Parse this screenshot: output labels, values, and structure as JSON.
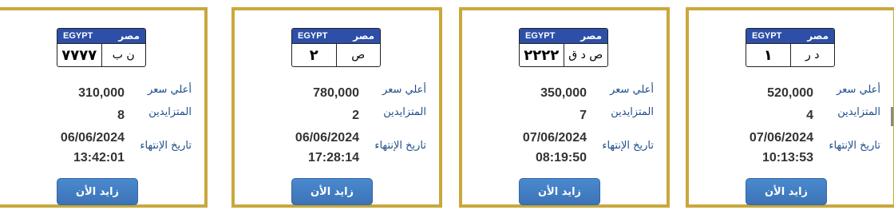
{
  "cards": [
    {
      "plate": {
        "country_en": "EGYPT",
        "country_ar": "مصر",
        "number": "٧٧٧٧",
        "letters": "ن ب"
      },
      "highest_price_label": "أعلي سعر",
      "highest_price": "310,000",
      "bidders_label": "المتزايدين",
      "bidders": "8",
      "end_date_label": "تاريخ الإنتهاء",
      "end_date": "06/06/2024",
      "end_time": "13:42:01",
      "bid_button": "زايد الأن"
    },
    {
      "plate": {
        "country_en": "EGYPT",
        "country_ar": "مصر",
        "number": "٢",
        "letters": "ص"
      },
      "highest_price_label": "أعلي سعر",
      "highest_price": "780,000",
      "bidders_label": "المتزايدين",
      "bidders": "2",
      "end_date_label": "تاريخ الإنتهاء",
      "end_date": "06/06/2024",
      "end_time": "17:28:14",
      "bid_button": "زايد الأن"
    },
    {
      "plate": {
        "country_en": "EGYPT",
        "country_ar": "مصر",
        "number": "٢٢٢٢",
        "letters": "ص د ق"
      },
      "highest_price_label": "أعلي سعر",
      "highest_price": "350,000",
      "bidders_label": "المتزايدين",
      "bidders": "7",
      "end_date_label": "تاريخ الإنتهاء",
      "end_date": "07/06/2024",
      "end_time": "08:19:50",
      "bid_button": "زايد الأن"
    },
    {
      "plate": {
        "country_en": "EGYPT",
        "country_ar": "مصر",
        "number": "١",
        "letters": "د ر"
      },
      "highest_price_label": "أعلي سعر",
      "highest_price": "520,000",
      "bidders_label": "المتزايدين",
      "bidders": "4",
      "end_date_label": "تاريخ الإنتهاء",
      "end_date": "07/06/2024",
      "end_time": "10:13:53",
      "bid_button": "زايد الأن"
    }
  ],
  "colors": {
    "card_border": "#c9a83c",
    "plate_header": "#2d4fa8",
    "label_text": "#1f4e8c",
    "button": "#3c73b6"
  }
}
